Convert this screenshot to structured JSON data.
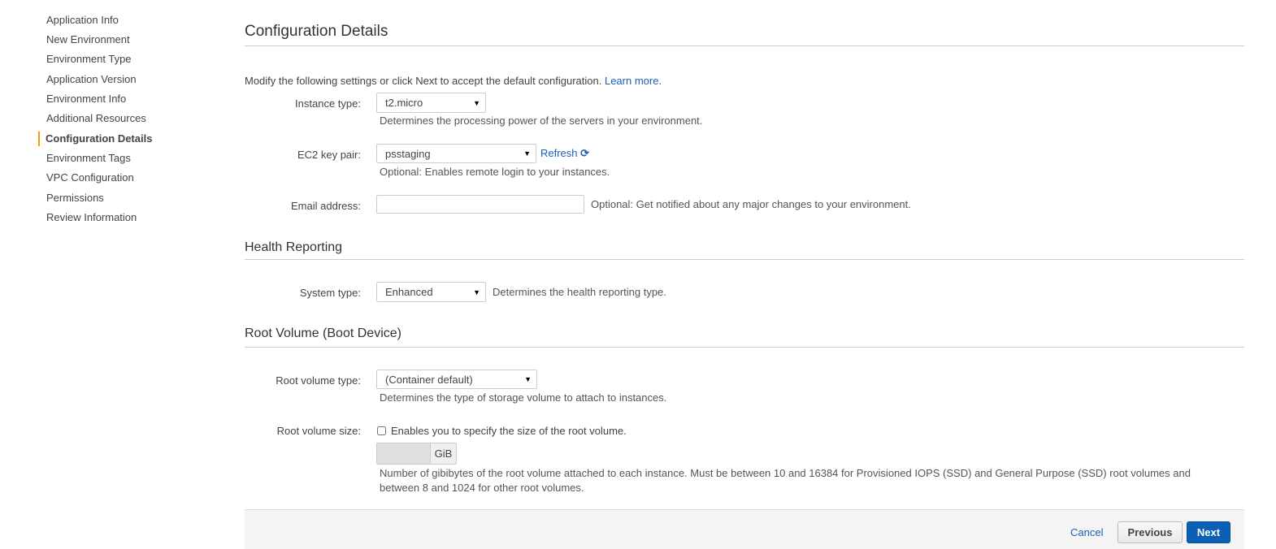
{
  "sidebar": {
    "items": [
      {
        "label": "Application Info"
      },
      {
        "label": "New Environment"
      },
      {
        "label": "Environment Type"
      },
      {
        "label": "Application Version"
      },
      {
        "label": "Environment Info"
      },
      {
        "label": "Additional Resources"
      },
      {
        "label": "Configuration Details",
        "active": true
      },
      {
        "label": "Environment Tags"
      },
      {
        "label": "VPC Configuration"
      },
      {
        "label": "Permissions"
      },
      {
        "label": "Review Information"
      }
    ]
  },
  "main": {
    "title": "Configuration Details",
    "intro": "Modify the following settings or click Next to accept the default configuration.",
    "learn_more": "Learn more.",
    "instance_type": {
      "label": "Instance type:",
      "value": "t2.micro",
      "help": "Determines the processing power of the servers in your environment."
    },
    "key_pair": {
      "label": "EC2 key pair:",
      "value": "psstaging",
      "refresh": "Refresh",
      "help": "Optional: Enables remote login to your instances."
    },
    "email": {
      "label": "Email address:",
      "value": "",
      "help": "Optional: Get notified about any major changes to your environment."
    },
    "health": {
      "title": "Health Reporting",
      "label": "System type:",
      "value": "Enhanced",
      "help": "Determines the health reporting type."
    },
    "root": {
      "title": "Root Volume (Boot Device)",
      "type_label": "Root volume type:",
      "type_value": "(Container default)",
      "type_help": "Determines the type of storage volume to attach to instances.",
      "size_label": "Root volume size:",
      "size_checkbox": "Enables you to specify the size of the root volume.",
      "size_checked": false,
      "size_value": "",
      "unit": "GiB",
      "size_help": "Number of gibibytes of the root volume attached to each instance. Must be between 10 and 16384 for Provisioned IOPS (SSD) and General Purpose (SSD) root volumes and between 8 and 1024 for other root volumes."
    }
  },
  "footer": {
    "cancel": "Cancel",
    "previous": "Previous",
    "next": "Next"
  },
  "colors": {
    "accent": "#ff9900",
    "link": "#1d60b4",
    "primary": "#0b5fb5"
  }
}
